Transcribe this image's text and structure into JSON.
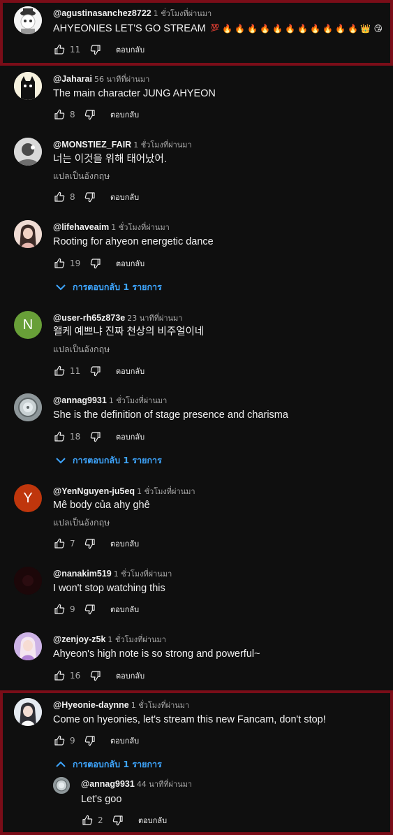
{
  "ui": {
    "reply_label": "ตอบกลับ",
    "translate_label": "แปลเป็นอังกฤษ",
    "replies_one": "การตอบกลับ 1 รายการ"
  },
  "colors": {
    "background": "#0f0f0f",
    "link": "#3ea6ff",
    "highlight_border": "#7a0d18"
  },
  "comments": [
    {
      "author": "@agustinasanchez8722",
      "time": "1 ชั่วโมงที่ผ่านมา",
      "text": "AHYEONIES LET'S GO STREAM",
      "emojis": [
        "💯",
        "🔥",
        "🔥",
        "🔥",
        "🔥",
        "🔥",
        "🔥",
        "🔥",
        "🔥",
        "🔥",
        "🔥",
        "🔥",
        "👑",
        "😘"
      ],
      "likes": "11",
      "avatar": "character-avatar"
    },
    {
      "author": "@Jaharai",
      "time": "56 นาทีที่ผ่านมา",
      "text": "The main character JUNG AHYEON",
      "likes": "8",
      "avatar": "black-cat-avatar"
    },
    {
      "author": "@MONSTIEZ_FAIR",
      "time": "1 ชั่วโมงที่ผ่านมา",
      "text": "너는 이것을 위해 태어났어.",
      "likes": "8",
      "avatar": "photo-avatar"
    },
    {
      "author": "@lifehaveaim",
      "time": "1 ชั่วโมงที่ผ่านมา",
      "text": "Rooting for ahyeon energetic dance",
      "likes": "19",
      "avatar": "photo-avatar"
    },
    {
      "author": "@user-rh65z873e",
      "time": "23 นาทีที่ผ่านมา",
      "text": "왤케 예쁘냐 진짜 천상의 비주얼이네",
      "likes": "11",
      "avatar_letter": "N",
      "avatar_color": "#689f38"
    },
    {
      "author": "@annag9931",
      "time": "1 ชั่วโมงที่ผ่านมา",
      "text": "She is the definition of stage presence and charisma",
      "likes": "18",
      "avatar": "photo-avatar"
    },
    {
      "author": "@YenNguyen-ju5eq",
      "time": "1 ชั่วโมงที่ผ่านมา",
      "text": "Mê body của ahy ghê",
      "likes": "7",
      "avatar_letter": "Y",
      "avatar_color": "#bf360c"
    },
    {
      "author": "@nanakim519",
      "time": "1 ชั่วโมงที่ผ่านมา",
      "text": "I won't stop watching this",
      "likes": "9",
      "avatar": "dark-avatar"
    },
    {
      "author": "@zenjoy-z5k",
      "time": "1 ชั่วโมงที่ผ่านมา",
      "text": "Ahyeon's high note is so strong and powerful~",
      "likes": "16",
      "avatar": "photo-avatar"
    },
    {
      "author": "@Hyeonie-daynne",
      "time": "1 ชั่วโมงที่ผ่านมา",
      "text": "Come on hyeonies, let's stream this new Fancam, don't stop!",
      "likes": "9",
      "avatar": "photo-avatar"
    }
  ],
  "reply": {
    "author": "@annag9931",
    "time": "44 นาทีที่ผ่านมา",
    "text": "Let's goo",
    "likes": "2",
    "avatar": "photo-avatar"
  }
}
